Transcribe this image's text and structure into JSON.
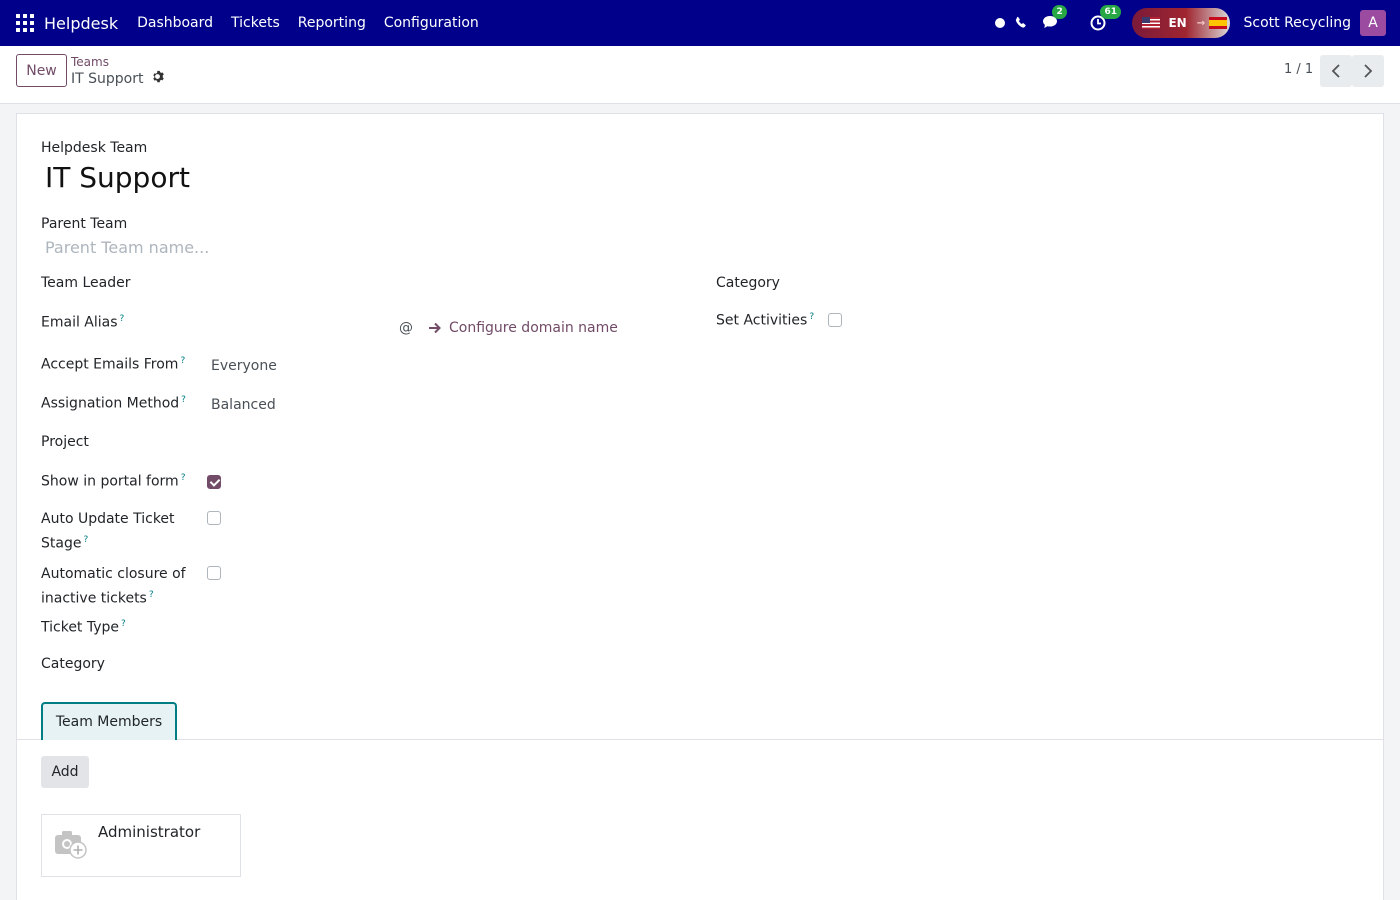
{
  "navbar": {
    "brand": "Helpdesk",
    "menu": [
      "Dashboard",
      "Tickets",
      "Reporting",
      "Configuration"
    ],
    "messages_badge": "2",
    "activities_badge": "61",
    "lang_code": "EN",
    "company": "Scott Recycling",
    "avatar_letter": "A"
  },
  "control": {
    "new_label": "New",
    "breadcrumb_parent": "Teams",
    "breadcrumb_current": "IT Support",
    "pager": "1 / 1"
  },
  "form": {
    "team_label": "Helpdesk Team",
    "team_name": "IT Support",
    "parent_team_label": "Parent Team",
    "parent_team_placeholder": "Parent Team name...",
    "team_leader_label": "Team Leader",
    "email_alias_label": "Email Alias",
    "at_sign": "@",
    "configure_domain": "Configure domain name",
    "accept_emails_label": "Accept Emails From",
    "accept_emails_value": "Everyone",
    "assignation_label": "Assignation Method",
    "assignation_value": "Balanced",
    "project_label": "Project",
    "portal_form_label": "Show in portal form",
    "portal_form_checked": true,
    "auto_update_label_1": "Auto Update Ticket",
    "auto_update_label_2": "Stage",
    "auto_update_checked": false,
    "auto_close_label_1": "Automatic closure of",
    "auto_close_label_2": "inactive tickets",
    "auto_close_checked": false,
    "ticket_type_label": "Ticket Type",
    "category_left_label": "Category",
    "category_right_label": "Category",
    "set_activities_label": "Set Activities",
    "set_activities_checked": false,
    "help_mark": "?"
  },
  "tabs": {
    "team_members": "Team Members",
    "add_label": "Add",
    "members": [
      "Administrator"
    ]
  },
  "colors": {
    "navbar": "#00008b",
    "accent": "#714b67",
    "tab_border": "#017e84"
  }
}
